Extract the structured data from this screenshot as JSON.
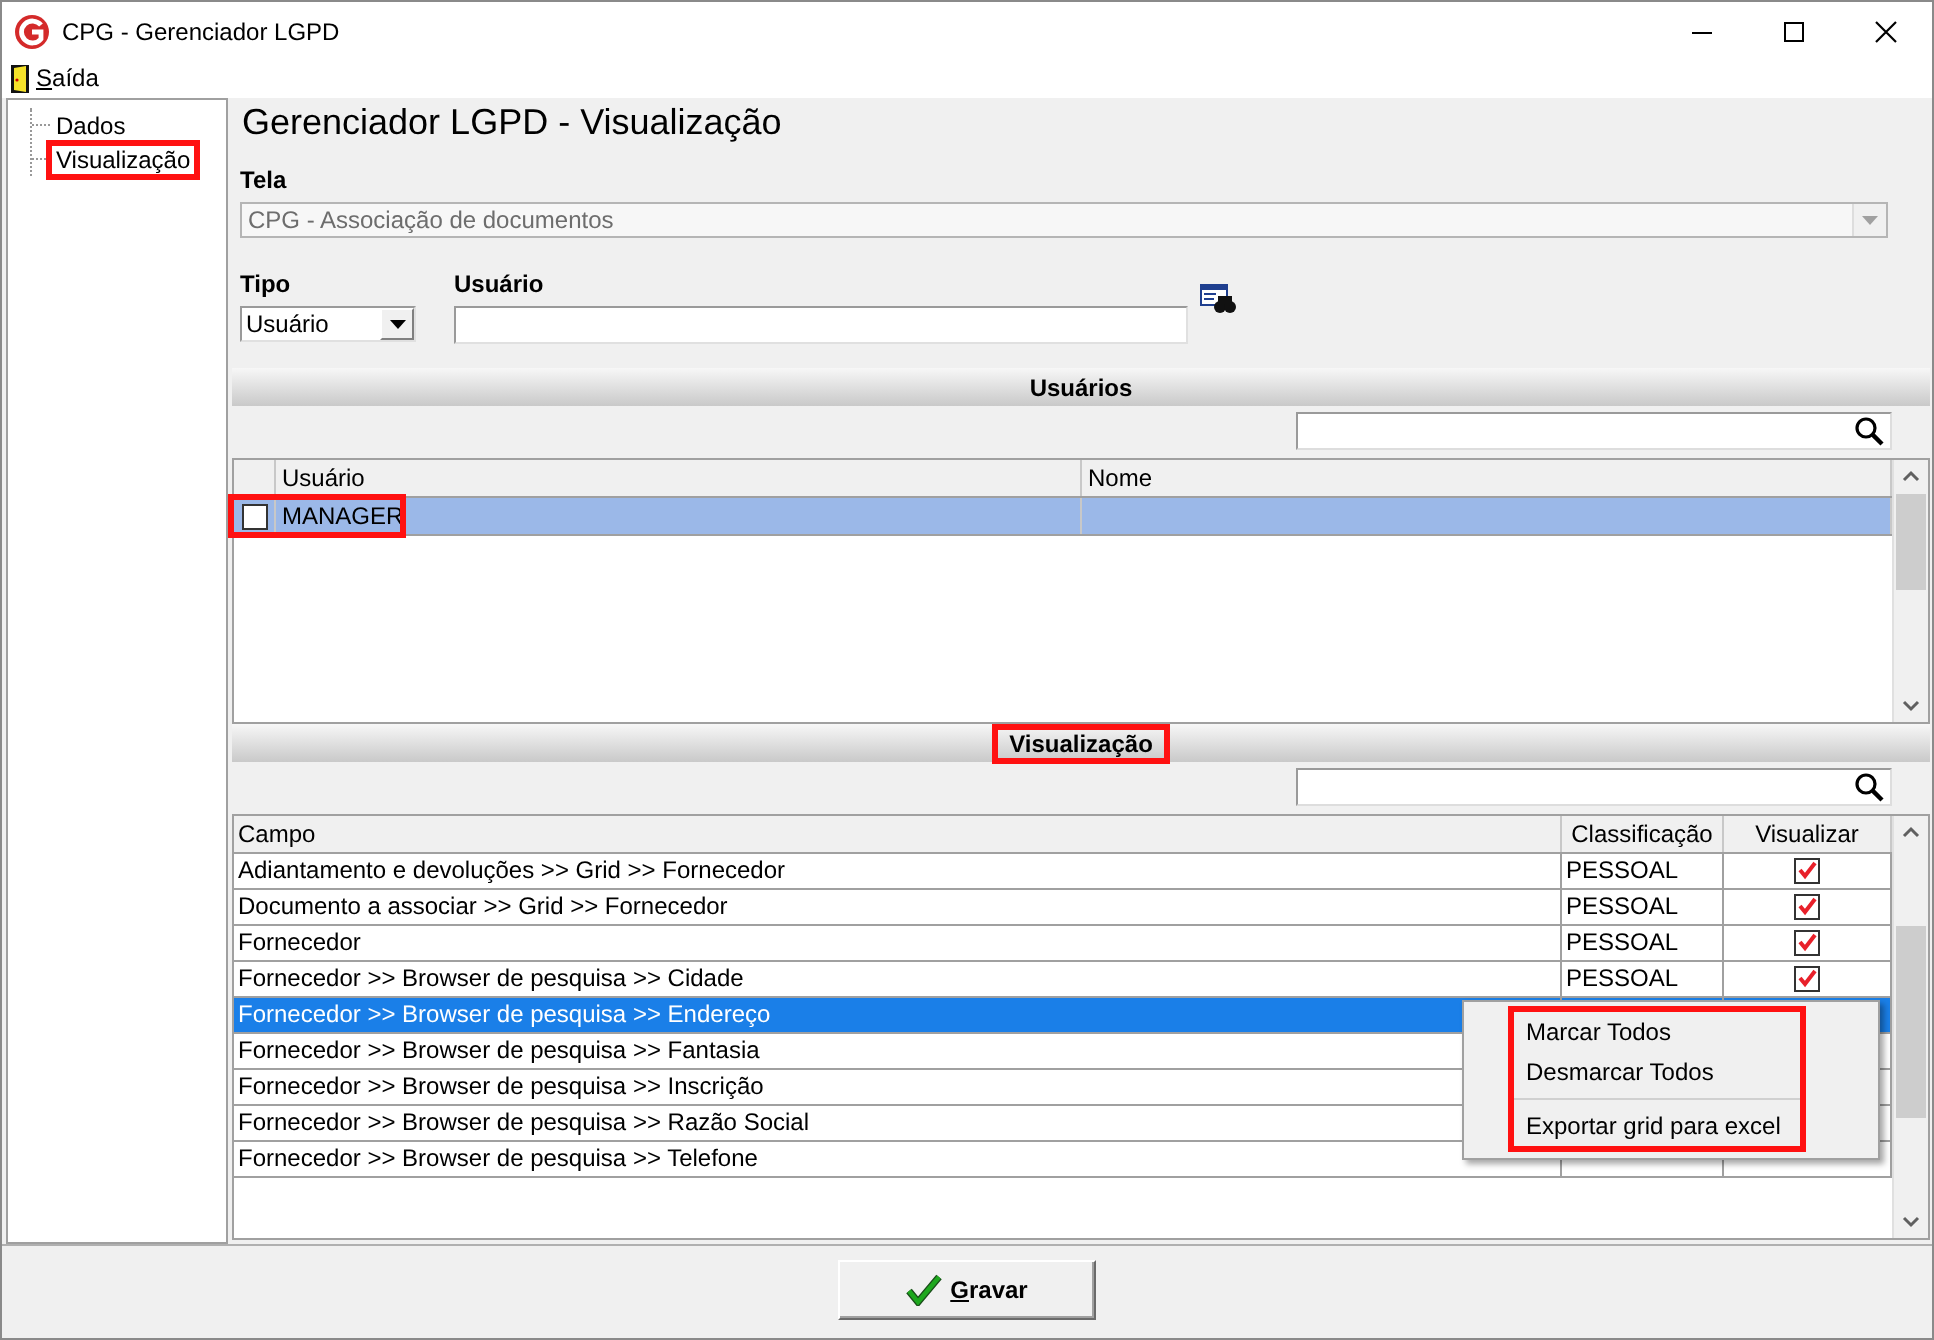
{
  "window": {
    "title": "CPG - Gerenciador LGPD"
  },
  "menu_bar": [
    {
      "label": "Saída"
    }
  ],
  "tree": [
    {
      "label": "Dados",
      "highlighted": false
    },
    {
      "label": "Visualização",
      "highlighted": true
    }
  ],
  "heading": "Gerenciador LGPD - Visualização",
  "tela": {
    "label": "Tela",
    "value": "CPG - Associação de documentos",
    "disabled": true
  },
  "tipo": {
    "label": "Tipo",
    "value": "Usuário"
  },
  "usuario": {
    "label": "Usuário"
  },
  "usuarios_section": {
    "title": "Usuários",
    "highlighted": false
  },
  "usuarios_grid": {
    "columns": [
      "Usuário",
      "Nome"
    ],
    "rows": [
      {
        "usuario": "MANAGER",
        "checked": false,
        "selected": true,
        "highlighted": true
      }
    ]
  },
  "visualizacao_section": {
    "title": "Visualização",
    "highlighted": true
  },
  "campos_grid": {
    "columns": [
      "Campo",
      "Classificação",
      "Visualizar"
    ],
    "rows": [
      {
        "campo": "Adiantamento e devoluções >> Grid >> Fornecedor",
        "classificacao": "PESSOAL",
        "visualizar": true,
        "selected": false
      },
      {
        "campo": "Documento a associar >> Grid >> Fornecedor",
        "classificacao": "PESSOAL",
        "visualizar": true,
        "selected": false
      },
      {
        "campo": "Fornecedor",
        "classificacao": "PESSOAL",
        "visualizar": true,
        "selected": false
      },
      {
        "campo": "Fornecedor >> Browser de pesquisa >> Cidade",
        "classificacao": "PESSOAL",
        "visualizar": true,
        "selected": false
      },
      {
        "campo": "Fornecedor >> Browser de pesquisa >> Endereço",
        "selected": true
      },
      {
        "campo": "Fornecedor >> Browser de pesquisa >> Fantasia",
        "selected": false
      },
      {
        "campo": "Fornecedor >> Browser de pesquisa >> Inscrição",
        "selected": false
      },
      {
        "campo": "Fornecedor >> Browser de pesquisa >> Razão Social",
        "selected": false
      },
      {
        "campo": "Fornecedor >> Browser de pesquisa >> Telefone",
        "selected": false
      }
    ]
  },
  "context_menu": {
    "highlighted": true,
    "items": [
      {
        "kind": "item",
        "label": "Marcar Todos"
      },
      {
        "kind": "item",
        "label": "Desmarcar Todos"
      },
      {
        "kind": "separator"
      },
      {
        "kind": "item",
        "label": "Exportar grid para excel"
      }
    ]
  },
  "save_button": {
    "label": "Gravar"
  }
}
